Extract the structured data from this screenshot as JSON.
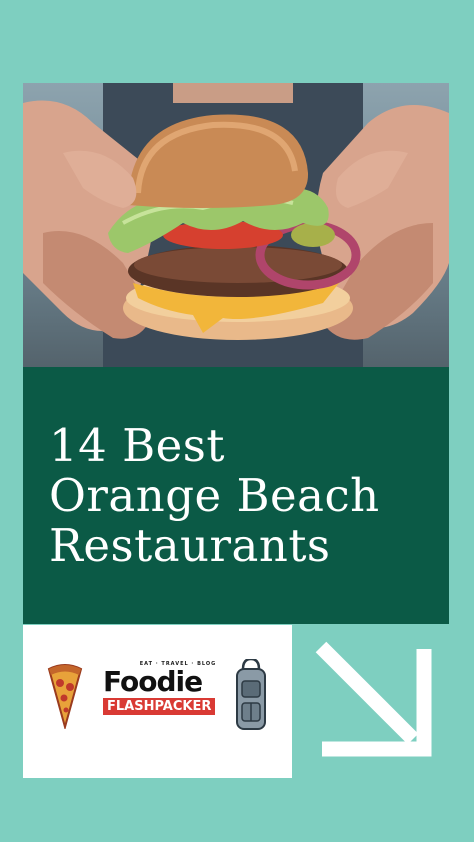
{
  "pin": {
    "title_lines": [
      "14 Best",
      "Orange Beach",
      "Restaurants"
    ],
    "brand": {
      "tagline": "EAT · TRAVEL · BLOG",
      "name_top": "Foodie",
      "name_bottom": "FLASHPACKER"
    },
    "photo": {
      "subject": "burger-held-in-hands-image"
    },
    "icons": [
      "arrow-down-right-icon",
      "pizza-icon",
      "backpack-icon"
    ]
  },
  "colors": {
    "background": "#7ecfc0",
    "title_panel": "#0b5a46",
    "title_text": "#ffffff",
    "logo_panel": "#ffffff",
    "arrow": "#ffffff",
    "brand_red": "#d93a34"
  }
}
